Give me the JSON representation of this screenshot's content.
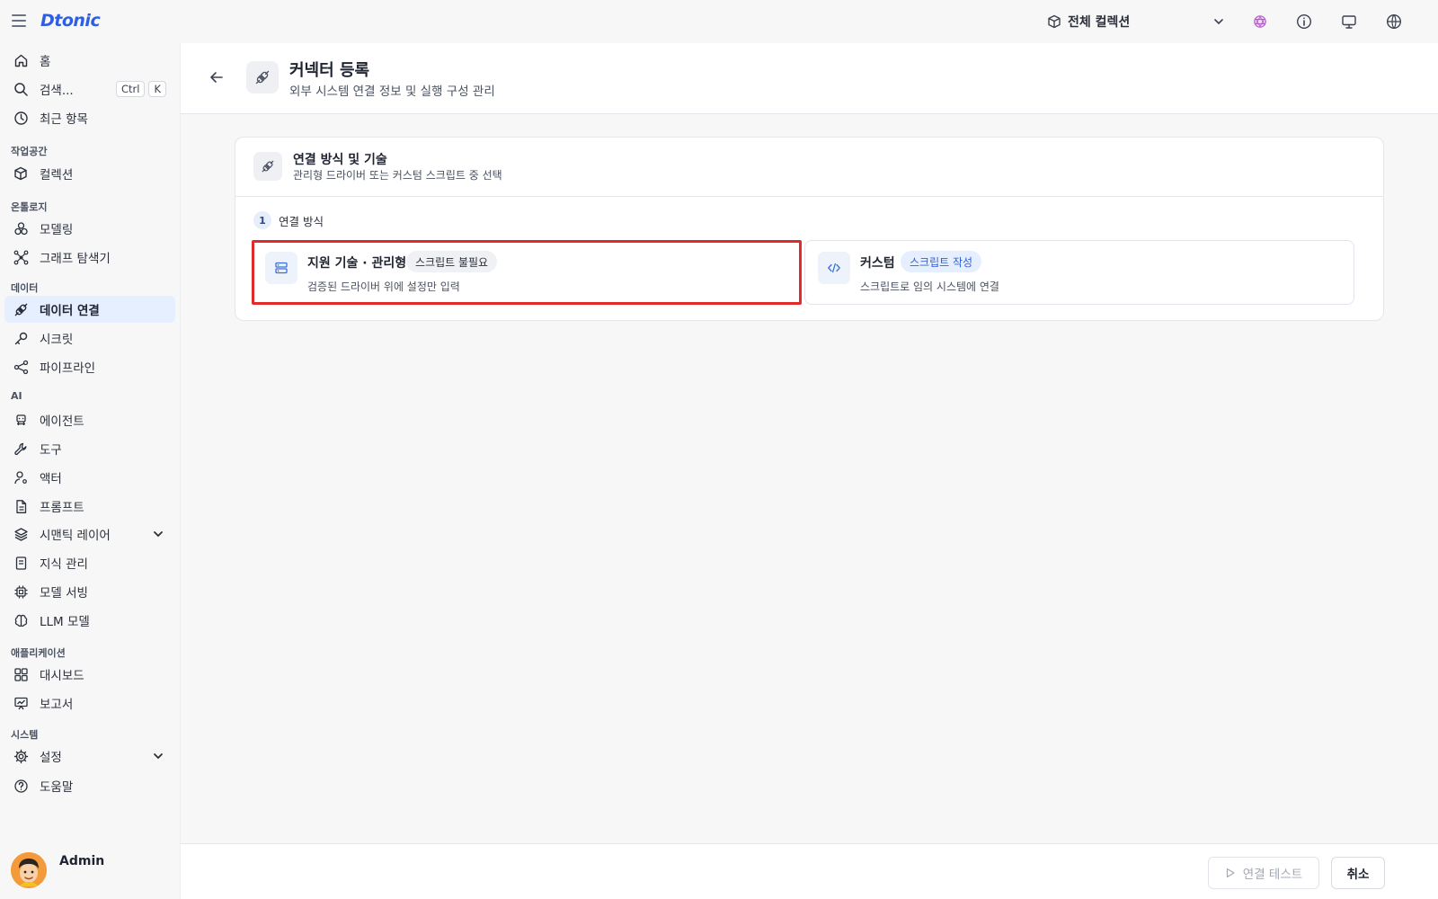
{
  "app": {
    "logo": "Dtonic"
  },
  "topbar": {
    "collection_selector": "전체 컬렉션",
    "icons": [
      "menu-icon",
      "cube-icon",
      "chevron-down-icon",
      "graph-icon",
      "info-icon",
      "monitor-icon",
      "globe-icon"
    ]
  },
  "sidebar": {
    "home": "홈",
    "search": "검색...",
    "search_kbd": [
      "Ctrl",
      "K"
    ],
    "recent": "최근 항목",
    "sections": {
      "workspace": "작업공간",
      "ontology": "온톨로지",
      "data": "데이터",
      "ai": "AI",
      "applications": "애플리케이션",
      "system": "시스템"
    },
    "items": {
      "collection": "컬렉션",
      "modeling": "모델링",
      "graph_explorer": "그래프 탐색기",
      "data_connection": "데이터 연결",
      "secret": "시크릿",
      "pipeline": "파이프라인",
      "agent": "에이전트",
      "tool": "도구",
      "actor": "액터",
      "prompt": "프롬프트",
      "semantic_layer": "시맨틱 레이어",
      "knowledge": "지식 관리",
      "model_serving": "모델 서빙",
      "llm_model": "LLM 모델",
      "dashboard": "대시보드",
      "report": "보고서",
      "settings": "설정",
      "help": "도움말"
    },
    "active": "data_connection",
    "user": "Admin"
  },
  "header": {
    "title": "커넥터 등록",
    "subtitle": "외부 시스템 연결 정보 및 실행 구성 관리"
  },
  "card": {
    "title": "연결 방식 및 기술",
    "subtitle": "관리형 드라이버 또는 커스텀 스크립트 중 선택",
    "step_number": "1",
    "step_label": "연결 방식",
    "options": [
      {
        "title": "지원 기술 · 관리형",
        "badge": "스크립트 불필요",
        "desc": "검증된 드라이버 위에 설정만 입력",
        "selected": true
      },
      {
        "title": "커스텀",
        "badge": "스크립트 작성",
        "desc": "스크립트로 임의 시스템에 연결",
        "selected": false
      }
    ]
  },
  "footer": {
    "test_button": "연결 테스트",
    "cancel_button": "취소"
  },
  "colors": {
    "accent": "#2f5fe0",
    "active_bg": "#e6efff",
    "selected_border": "#e02b2b",
    "badge_blue_bg": "#e6efff",
    "badge_blue_text": "#2f5fe0",
    "badge_gray_bg": "#f0f1f4"
  }
}
